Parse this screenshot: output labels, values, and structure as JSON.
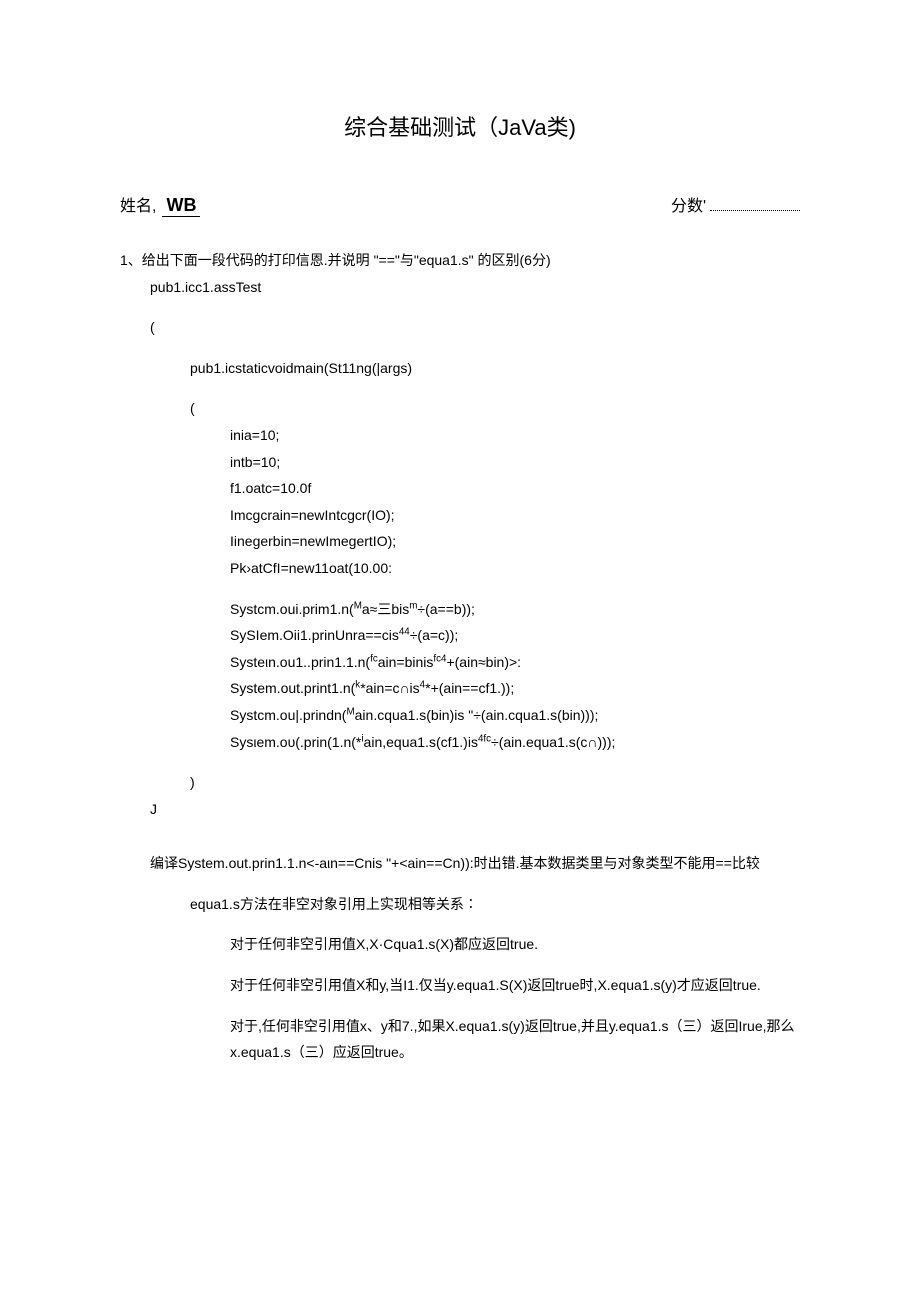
{
  "title": "综合基础测试（JaVa类)",
  "header": {
    "name_label": "姓名,",
    "name_value": "WB",
    "score_label": "分数'"
  },
  "q1": {
    "prompt": "1、给出下面一段代码的打印信恩.并说明 \"==\"与\"equa1.s\" 的区别(6分)",
    "c1": "pub1.icc1.assTest",
    "c2": "(",
    "c3": "pub1.icstaticvoidmain(St11ng(|args)",
    "c4": "(",
    "c5": "inia=10;",
    "c6": "intb=10;",
    "c7": "f1.oatc=10.0f",
    "c8": "Imcgcrain=newIntcgcr(IO);",
    "c9": "Iinegerbin=newImegertIO);",
    "c10": "Pk›atCfI=new11oat(10.00:",
    "c11a": "Systcm.oui.prim1.n(",
    "c11b": "a≈三bis",
    "c11c": "÷(a==b));",
    "c12a": "SySIem.Oii1.prinUnra==cis",
    "c12b": "÷(a=c));",
    "c13a": "Systeιn.ou1..prin1.1.n(",
    "c13b": "ain=binis",
    "c13c": "+(ain≈bin)>:",
    "c14a": "System.out.print1.n(",
    "c14b": "*ain=c∩is",
    "c14c": "*+(ain==cf1.));",
    "c15a": "Systcm.ou|.prindn(",
    "c15b": "ain.cqua1.s(bin)is \"÷(ain.cqua1.s(bin)));",
    "c16a": "Sysιem.oυ(.prin(1.n(*",
    "c16b": "ain,equa1.s(cf1.)is",
    "c16c": "÷(ain.equa1.s(c∩)));",
    "c17": ")",
    "c18": "J",
    "exp1": "编译System.out.prin1.1.n<-aιn==Cnis \"+<ain==Cn)):时出错.基本数据类里与对象类型不能用==比较",
    "exp2": "equa1.s方法在非空对象引用上实现相等关系∶",
    "exp3": "对于任何非空引用值X,X·Cqua1.s(X)都应返回true.",
    "exp4": "对于任何非空引用值X和y,当I1.仅当y.equa1.S(X)返回true时,X.equa1.s(y)才应返回true.",
    "exp5": "对于,任何非空引用值x、y和7.,如果X.equa1.s(y)返回true,并且y.equa1.s（三）返回Irue,那么x.equa1.s（三）应返回true。"
  }
}
